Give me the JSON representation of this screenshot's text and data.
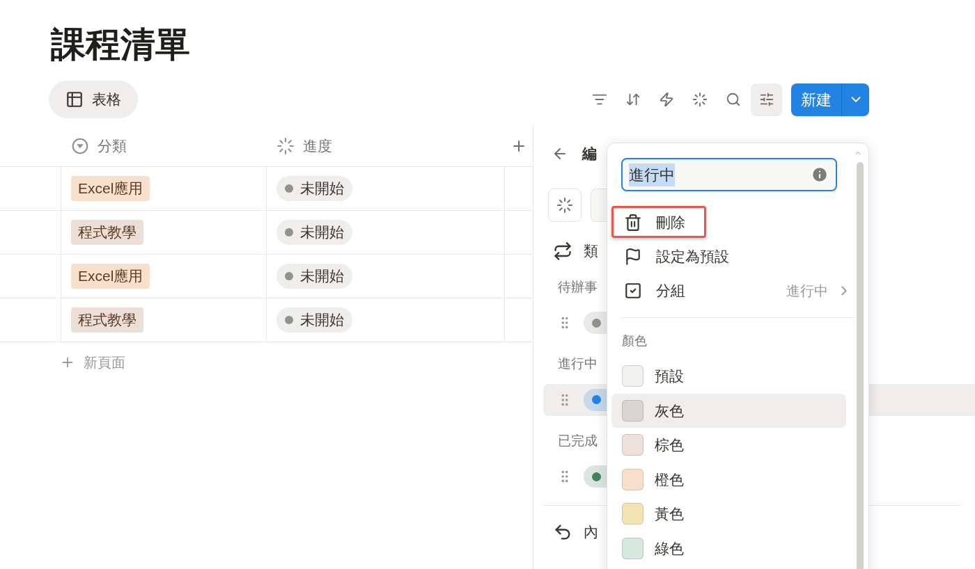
{
  "page": {
    "title": "課程清單"
  },
  "view_tabs": [
    {
      "label": "表格",
      "selected": true
    }
  ],
  "toolbar": [
    {
      "kind": "filter",
      "selected": false
    },
    {
      "kind": "sort",
      "selected": false
    },
    {
      "kind": "automation",
      "selected": false
    },
    {
      "kind": "ai",
      "selected": false
    },
    {
      "kind": "search",
      "selected": false
    },
    {
      "kind": "settings",
      "selected": true
    }
  ],
  "new_button": {
    "label": "新建"
  },
  "table": {
    "columns": [
      {
        "label": "分類",
        "kind": "select"
      },
      {
        "label": "進度",
        "kind": "status"
      }
    ],
    "rows": [
      {
        "category": {
          "text": "Excel應用",
          "color": "#f8e0cc"
        },
        "status": "未開始"
      },
      {
        "category": {
          "text": "程式教學",
          "color": "#ecdfd8"
        },
        "status": "未開始"
      },
      {
        "category": {
          "text": "Excel應用",
          "color": "#f8e0cc"
        },
        "status": "未開始"
      },
      {
        "category": {
          "text": "程式教學",
          "color": "#ecdfd8"
        },
        "status": "未開始"
      }
    ],
    "new_row": "新頁面"
  },
  "panel": {
    "title": "編",
    "type_label": "類",
    "footer_label": "內",
    "groups": [
      {
        "label": "待辦事",
        "options": [
          {
            "color": "#91918e",
            "selected": false
          }
        ]
      },
      {
        "label": "進行中",
        "options": [
          {
            "color": "#2383e2",
            "selected": true
          }
        ]
      },
      {
        "label": "已完成",
        "options": [
          {
            "color": "#448361",
            "selected": false
          }
        ]
      }
    ]
  },
  "popup": {
    "name_value": "進行中",
    "actions": [
      {
        "kind": "delete",
        "label": "刪除",
        "outlined": true
      },
      {
        "kind": "default",
        "label": "設定為預設",
        "outlined": false
      },
      {
        "kind": "group",
        "label": "分組",
        "value": "進行中",
        "outlined": false
      }
    ],
    "colors_heading": "顏色",
    "colors": [
      {
        "label": "預設",
        "color": "#f1f1ef",
        "highlighted": false
      },
      {
        "label": "灰色",
        "color": "#d8d6d3",
        "highlighted": true
      },
      {
        "label": "棕色",
        "color": "#eee0da",
        "highlighted": false
      },
      {
        "label": "橙色",
        "color": "#f8dfcc",
        "highlighted": false
      },
      {
        "label": "黃色",
        "color": "#f6e3b4",
        "highlighted": false
      },
      {
        "label": "綠色",
        "color": "#d7e8de",
        "highlighted": false
      }
    ]
  }
}
